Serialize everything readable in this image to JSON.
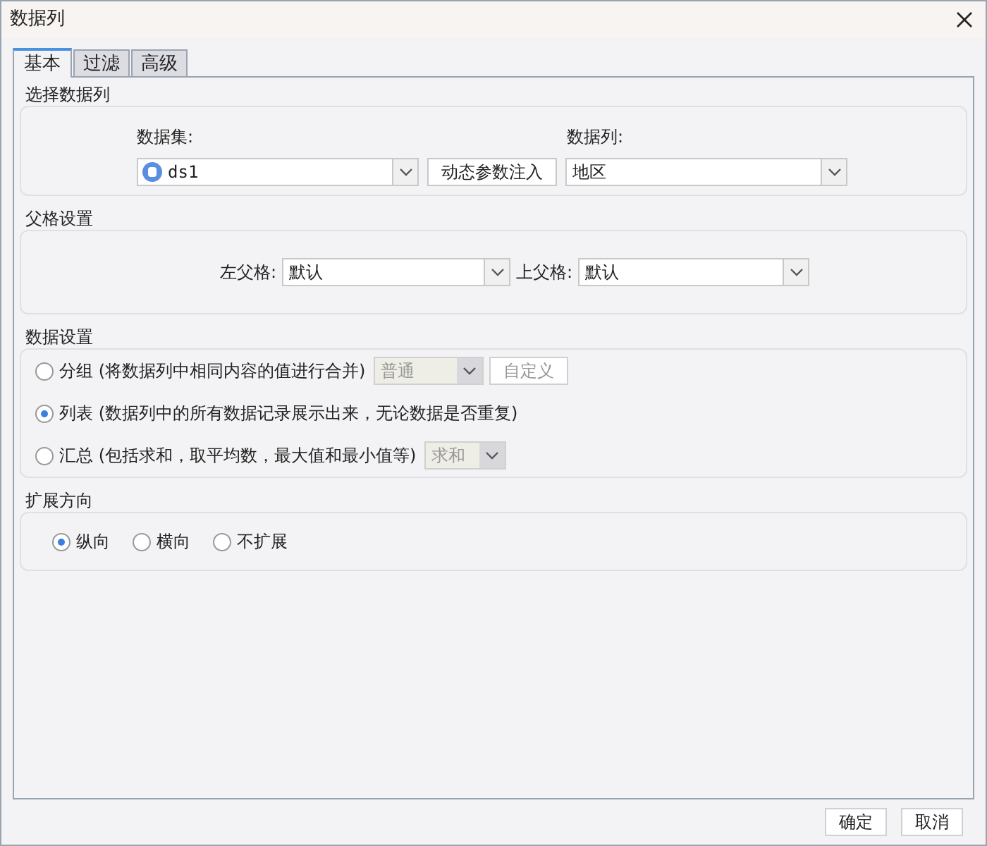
{
  "window": {
    "title": "数据列"
  },
  "tabs": [
    {
      "label": "基本",
      "selected": true
    },
    {
      "label": "过滤",
      "selected": false
    },
    {
      "label": "高级",
      "selected": false
    }
  ],
  "column_select": {
    "title": "选择数据列",
    "dataset_label": "数据集:",
    "dataset_value": "ds1",
    "dynamic_button": "动态参数注入",
    "column_label": "数据列:",
    "column_value": "地区"
  },
  "parent_cells": {
    "title": "父格设置",
    "left_label": "左父格:",
    "left_value": "默认",
    "top_label": "上父格:",
    "top_value": "默认"
  },
  "data_settings": {
    "title": "数据设置",
    "options": [
      {
        "kind": "group",
        "label": "分组 (将数据列中相同内容的值进行合并)",
        "selected": false,
        "combo": "普通",
        "button": "自定义"
      },
      {
        "kind": "plain",
        "label": "列表 (数据列中的所有数据记录展示出来，无论数据是否重复)",
        "selected": true
      },
      {
        "kind": "summary",
        "label": "汇总 (包括求和，取平均数，最大值和最小值等)",
        "selected": false,
        "combo": "求和"
      }
    ]
  },
  "expand_direction": {
    "title": "扩展方向",
    "options": [
      {
        "label": "纵向",
        "selected": true
      },
      {
        "label": "横向",
        "selected": false
      },
      {
        "label": "不扩展",
        "selected": false
      }
    ]
  },
  "buttons": [
    "确定",
    "取消"
  ]
}
